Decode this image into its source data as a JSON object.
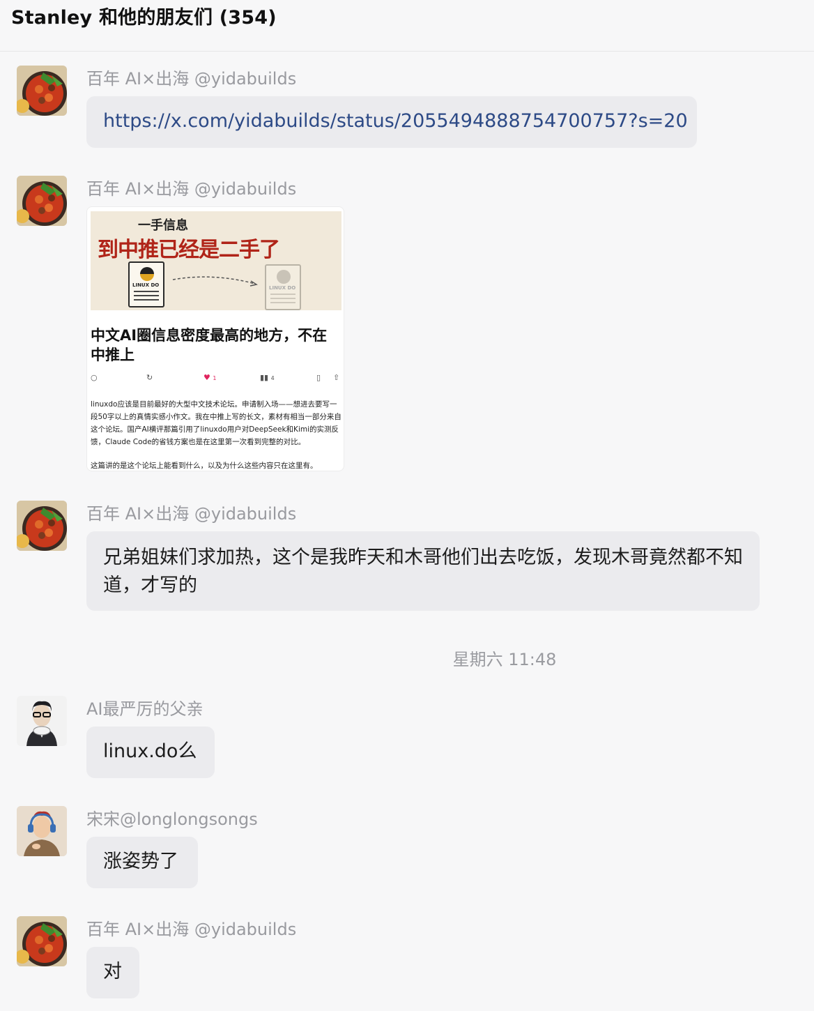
{
  "header": {
    "title": "Stanley 和他的朋友们 (354)"
  },
  "messages": [
    {
      "sender": "百年 AI×出海 @yidabuilds",
      "text": "https://x.com/yidabuilds/status/2055494888754700757?s=20"
    },
    {
      "sender": "百年 AI×出海 @yidabuilds",
      "card": {
        "banner_sub": "一手信息",
        "banner_main": "到中推已经是二手了",
        "doc_label": "LINUX DO",
        "title": "中文AI圈信息密度最高的地方，不在中推上",
        "likes": "1",
        "views": "4",
        "body_p1": "linuxdo应该是目前最好的大型中文技术论坛。申请制入场——想进去要写一段50字以上的真情实感小作文。我在中推上写的长文，素材有相当一部分来自这个论坛。国产AI横评那篇引用了linuxdo用户对DeepSeek和Kimi的实测反馈，Claude Code的省钱方案也是在这里第一次看到完整的对比。",
        "body_p2": "这篇讲的是这个论坛上能看到什么，以及为什么这些内容只在这里有。"
      }
    },
    {
      "sender": "百年 AI×出海 @yidabuilds",
      "text": "兄弟姐妹们求加热，这个是我昨天和木哥他们出去吃饭，发现木哥竟然都不知道，才写的"
    },
    {
      "sender": "AI最严厉的父亲",
      "text": "linux.do么"
    },
    {
      "sender": "宋宋@longlongsongs",
      "text": "涨姿势了"
    },
    {
      "sender": "百年 AI×出海 @yidabuilds",
      "text": "对"
    }
  ],
  "timestamp": "星期六 11:48",
  "icons": {
    "avatar_food": "food-bowl-avatar-icon",
    "avatar_glasses": "man-with-glasses-avatar-icon",
    "avatar_headphones": "man-with-headphones-avatar-icon"
  }
}
